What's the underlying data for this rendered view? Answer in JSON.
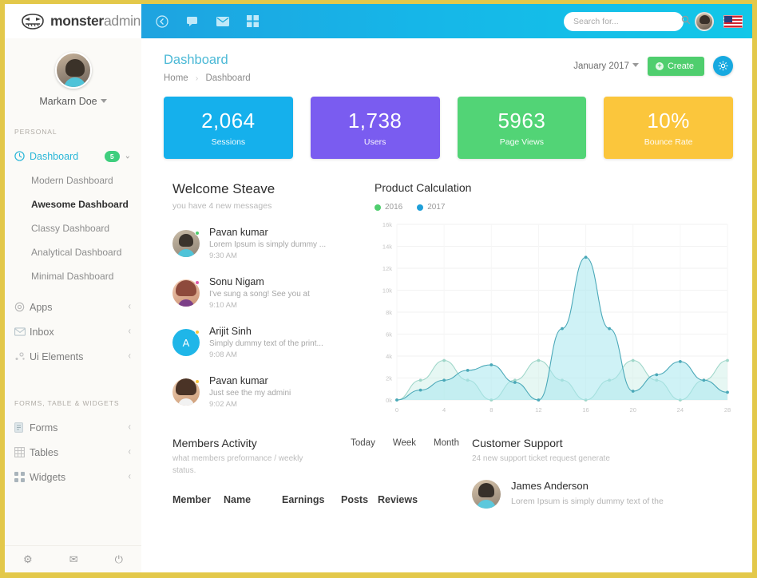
{
  "brand": {
    "bold": "monster",
    "light": "admin",
    "logo_icon": "monster-face-icon"
  },
  "topbar": {
    "icons": [
      {
        "name": "back-arrow-icon",
        "glyph": "←"
      },
      {
        "name": "flag-message-icon",
        "glyph": "⚑"
      },
      {
        "name": "envelope-icon",
        "glyph": "✉"
      },
      {
        "name": "grid-apps-icon",
        "glyph": "▦"
      }
    ],
    "search": {
      "placeholder": "Search for...",
      "value": "",
      "icon": "search-icon"
    },
    "avatar": "user-avatar",
    "flag": "us-flag-icon"
  },
  "sidebar": {
    "profile": {
      "name": "Markarn Doe",
      "avatar": "profile-avatar"
    },
    "section_personal": "PERSONAL",
    "section_forms": "FORMS, TABLE & WIDGETS",
    "dashboard": {
      "label": "Dashboard",
      "badge": "5",
      "icon": "dashboard-icon"
    },
    "sub_items": [
      {
        "label": "Modern Dashboard",
        "selected": false
      },
      {
        "label": "Awesome Dashboard",
        "selected": true
      },
      {
        "label": "Classy Dashboard",
        "selected": false
      },
      {
        "label": "Analytical Dashboard",
        "selected": false
      },
      {
        "label": "Minimal Dashboard",
        "selected": false
      }
    ],
    "items": [
      {
        "label": "Apps",
        "icon": "apps-icon"
      },
      {
        "label": "Inbox",
        "icon": "inbox-envelope-icon"
      },
      {
        "label": "Ui Elements",
        "icon": "ui-elements-icon"
      }
    ],
    "items2": [
      {
        "label": "Forms",
        "icon": "forms-icon"
      },
      {
        "label": "Tables",
        "icon": "tables-icon"
      },
      {
        "label": "Widgets",
        "icon": "widgets-icon"
      }
    ],
    "footer_icons": [
      {
        "name": "settings-gear-icon",
        "glyph": "⚙"
      },
      {
        "name": "mail-icon",
        "glyph": "✉"
      },
      {
        "name": "power-icon",
        "glyph": "⏻"
      }
    ]
  },
  "page": {
    "title": "Dashboard",
    "breadcrumb": {
      "home": "Home",
      "current": "Dashboard",
      "separator": "›"
    },
    "month_select": "January 2017",
    "create_label": "Create",
    "create_plus": "+",
    "gear_icon": "settings-gear-icon"
  },
  "stats": [
    {
      "value": "2,064",
      "label": "Sessions",
      "color": "#15b0ec"
    },
    {
      "value": "1,738",
      "label": "Users",
      "color": "#7a5cf0"
    },
    {
      "value": "5963",
      "label": "Page Views",
      "color": "#52d476"
    },
    {
      "value": "10%",
      "label": "Bounce Rate",
      "color": "#fbc63c"
    }
  ],
  "welcome": {
    "title": "Welcome Steave",
    "subtitle": "you have 4 new messages",
    "messages": [
      {
        "name": "Pavan kumar",
        "text": "Lorem Ipsum is simply dummy ...",
        "time": "9:30 AM",
        "dot": "#4fce6e",
        "avatar": "av-p1"
      },
      {
        "name": "Sonu Nigam",
        "text": "I've sung a song! See you at",
        "time": "9:10 AM",
        "dot": "#e05ba8",
        "avatar": "av-p2"
      },
      {
        "name": "Arijit Sinh",
        "text": "Simply dummy text of the print...",
        "time": "9:08 AM",
        "dot": "#fbc63c",
        "avatar": "av-letter",
        "initial": "A"
      },
      {
        "name": "Pavan kumar",
        "text": "Just see the my admini",
        "time": "9:02 AM",
        "dot": "#fbc63c",
        "avatar": "av-p4"
      }
    ]
  },
  "members_activity": {
    "title": "Members Activity",
    "subtitle": "what members preformance / weekly status.",
    "tabs": [
      "Today",
      "Week",
      "Month"
    ],
    "columns": [
      "Member",
      "Name",
      "Earnings",
      "Posts",
      "Reviews"
    ]
  },
  "customer_support": {
    "title": "Customer Support",
    "subtitle": "24 new support ticket request generate",
    "person": {
      "name": "James Anderson",
      "text": "Lorem Ipsum is simply dummy text of the"
    }
  },
  "chart_data": {
    "type": "area",
    "title": "Product Calculation",
    "xlabel": "",
    "ylabel": "",
    "xlim": [
      0,
      28
    ],
    "ylim": [
      0,
      16000
    ],
    "grid": true,
    "legend_position": "top-left",
    "xticks": [
      "0",
      "4",
      "8",
      "12",
      "16",
      "20",
      "24",
      "28"
    ],
    "yticks": [
      "0k",
      "2k",
      "4k",
      "6k",
      "8k",
      "10k",
      "12k",
      "14k",
      "16k"
    ],
    "series": [
      {
        "name": "2016",
        "color": "#4fce6e",
        "line_color": "#9fd6c9",
        "x": [
          0,
          2,
          4,
          6,
          8,
          10,
          12,
          14,
          16,
          18,
          20,
          22,
          24,
          26,
          28
        ],
        "values": [
          0,
          1800,
          3600,
          1800,
          0,
          1800,
          3600,
          1800,
          0,
          1800,
          3600,
          1800,
          0,
          1800,
          3600
        ]
      },
      {
        "name": "2017",
        "color": "#1f9fd8",
        "line_color": "#4aa8b8",
        "x": [
          0,
          2,
          4,
          6,
          8,
          10,
          12,
          14,
          16,
          18,
          20,
          22,
          24,
          26,
          28
        ],
        "values": [
          0,
          900,
          1800,
          2700,
          3200,
          1600,
          0,
          6500,
          13000,
          6500,
          800,
          2300,
          3500,
          1800,
          700
        ]
      }
    ]
  }
}
